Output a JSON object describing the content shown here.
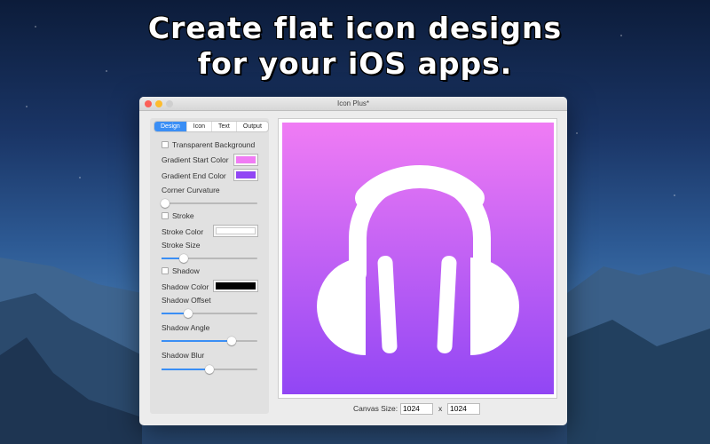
{
  "headline": {
    "line1": "Create flat icon designs",
    "line2": "for your iOS apps."
  },
  "window": {
    "title": "Icon Plus*"
  },
  "tabs": [
    {
      "label": "Design",
      "active": true
    },
    {
      "label": "Icon"
    },
    {
      "label": "Text"
    },
    {
      "label": "Output"
    }
  ],
  "design": {
    "transparent_background": {
      "label": "Transparent Background",
      "checked": false
    },
    "gradient_start": {
      "label": "Gradient Start Color",
      "color": "#f07cf4"
    },
    "gradient_end": {
      "label": "Gradient End Color",
      "color": "#9146f4"
    },
    "corner_curvature": {
      "label": "Corner Curvature",
      "value_pct": 0
    },
    "stroke": {
      "label": "Stroke",
      "checked": false
    },
    "stroke_color": {
      "label": "Stroke Color",
      "color": "#ffffff"
    },
    "stroke_size": {
      "label": "Stroke Size",
      "value_pct": 23
    },
    "shadow": {
      "label": "Shadow",
      "checked": false
    },
    "shadow_color": {
      "label": "Shadow Color",
      "color": "#000000"
    },
    "shadow_offset": {
      "label": "Shadow Offset",
      "value_pct": 28
    },
    "shadow_angle": {
      "label": "Shadow Angle",
      "value_pct": 73
    },
    "shadow_blur": {
      "label": "Shadow Blur",
      "value_pct": 50
    }
  },
  "canvas": {
    "icon": "headphones-icon",
    "size_label": "Canvas Size:",
    "width": "1024",
    "x_label": "x",
    "height": "1024"
  },
  "colors": {
    "accent": "#3a8ef5"
  }
}
